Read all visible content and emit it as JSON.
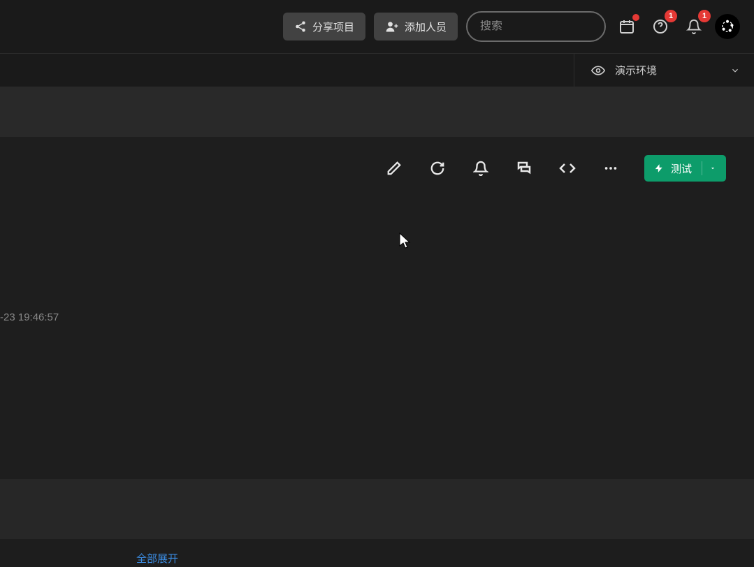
{
  "topbar": {
    "share_label": "分享项目",
    "add_person_label": "添加人员",
    "search_placeholder": "搜索",
    "help_badge": "1",
    "bell_badge": "1"
  },
  "env": {
    "label": "演示环境"
  },
  "toolbar": {
    "test_label": "测试"
  },
  "content": {
    "timestamp": "-23 19:46:57"
  },
  "footer": {
    "expand_all": "全部展开"
  }
}
